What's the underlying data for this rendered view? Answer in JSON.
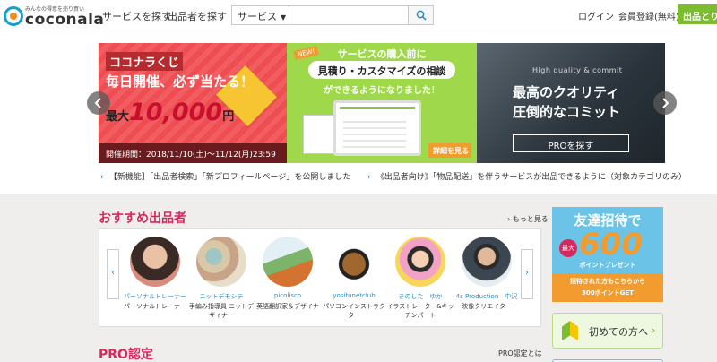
{
  "header": {
    "logo_tagline": "みんなの得意を売り買い",
    "logo_text": "coconala",
    "nav": [
      "サービスを探す",
      "出品者を探す"
    ],
    "search": {
      "category": "サービス",
      "value": "",
      "placeholder": ""
    },
    "login": "ログイン",
    "signup": "会員登録(無料)",
    "cta": "出品とり"
  },
  "carousel": {
    "banner1": {
      "line1": "ココナラくじ",
      "line2": "毎日開催、必ず当たる！",
      "prefix": "最大",
      "amount": "10,000",
      "unit": "円",
      "period": "開催期間：2018/11/10(土)〜11/12(月)23:59"
    },
    "banner2": {
      "badge": "NEW!",
      "line1": "サービスの購入前に",
      "line2": "見積り・カスタマイズの相談",
      "line3": "ができるようになりました！",
      "button": "詳細を見る"
    },
    "banner3": {
      "tagline": "High quality & commit",
      "line1": "最高のクオリティ",
      "line2": "圧倒的なコミット",
      "button": "PROを探す"
    }
  },
  "news": [
    "【新機能】「出品者検索」「新プロフィールページ」を公開しました",
    "《出品者向け》「物品配送」を伴うサービスが出品できるように（対象カテゴリのみ）"
  ],
  "recommended": {
    "title": "おすすめ出品者",
    "more": "もっと見る",
    "sellers": [
      {
        "name": "パーソナルトレーナー",
        "role": "パーソナルトレーナー"
      },
      {
        "name": "ニットデモシテ",
        "role": "手編み指導員 ニットデザイナー"
      },
      {
        "name": "picolisco",
        "role": "英語翻訳家＆デザイナー"
      },
      {
        "name": "yositunetclub",
        "role": "パソコンインストラクター"
      },
      {
        "name": "きのした　ゆか",
        "role": "イラストレーター&キッチンパート"
      },
      {
        "name": "4s Production　中沢",
        "role": "映像クリエイター"
      }
    ]
  },
  "pro": {
    "title": "PRO認定",
    "link": "PRO認定とは"
  },
  "invite_ad": {
    "title": "友達招待で",
    "max": "最大",
    "number": "600",
    "points": "ポイントプレゼント",
    "band1": "招待された方もこちらから",
    "band2": "300ポイントGET"
  },
  "first_time": {
    "label": "初めての方へ"
  }
}
